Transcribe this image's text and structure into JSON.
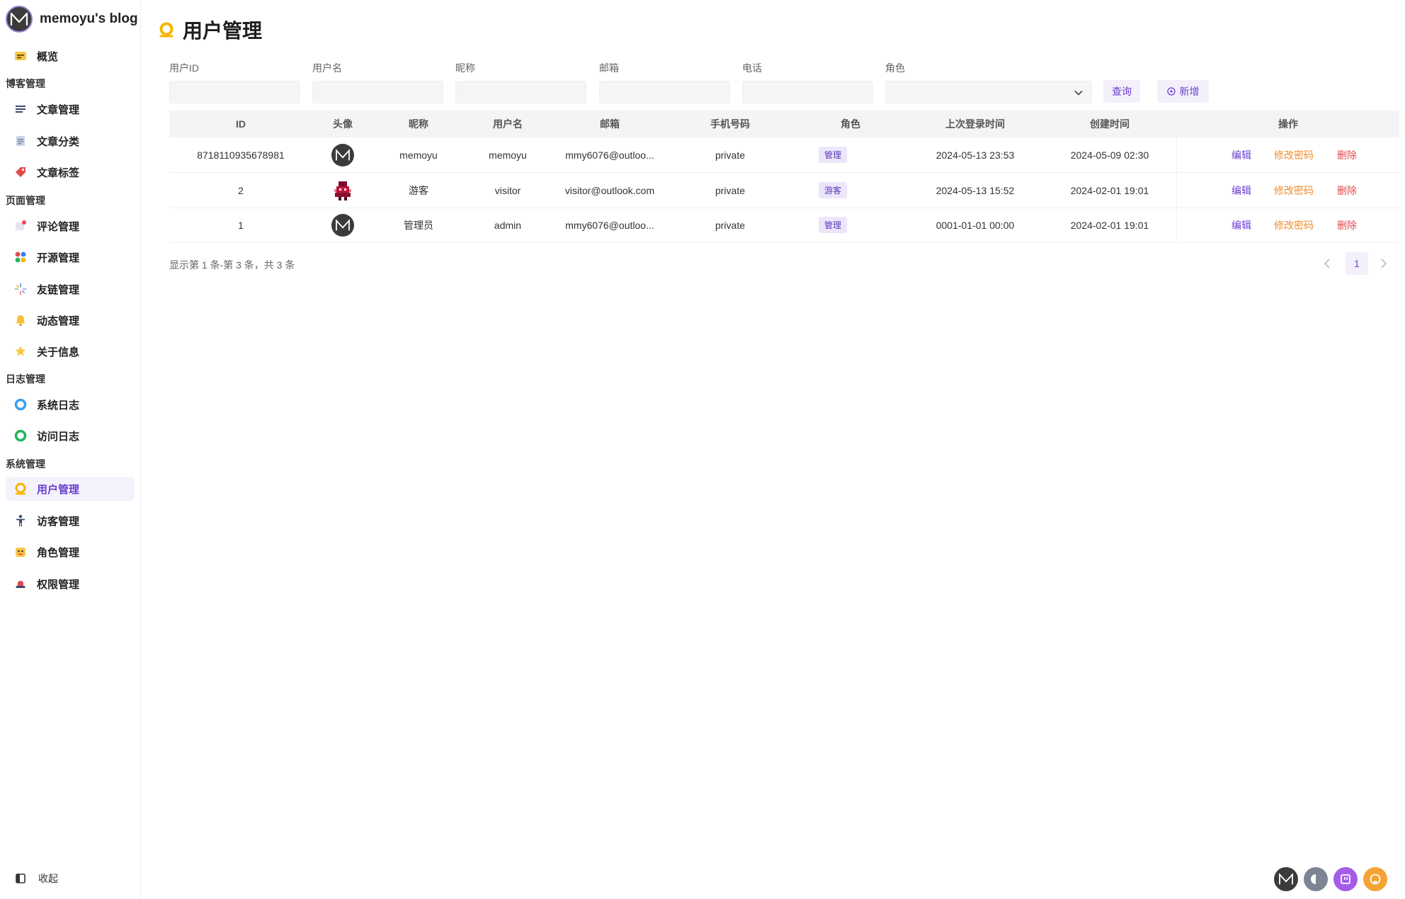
{
  "brand": {
    "title": "memoyu's blog"
  },
  "sidebar": {
    "overview": "概览",
    "groups": {
      "blog": "博客管理",
      "page": "页面管理",
      "log": "日志管理",
      "system": "系统管理"
    },
    "items": {
      "articles": "文章管理",
      "categories": "文章分类",
      "tags": "文章标签",
      "comments": "评论管理",
      "opensource": "开源管理",
      "friendlinks": "友链管理",
      "moments": "动态管理",
      "about": "关于信息",
      "syslog": "系统日志",
      "visitlog": "访问日志",
      "users": "用户管理",
      "visitors": "访客管理",
      "roles": "角色管理",
      "permissions": "权限管理"
    },
    "collapse": "收起"
  },
  "page": {
    "title": "用户管理"
  },
  "filters": {
    "user_id": {
      "label": "用户ID",
      "value": ""
    },
    "username": {
      "label": "用户名",
      "value": ""
    },
    "nickname": {
      "label": "昵称",
      "value": ""
    },
    "email": {
      "label": "邮箱",
      "value": ""
    },
    "phone": {
      "label": "电话",
      "value": ""
    },
    "role": {
      "label": "角色",
      "value": ""
    },
    "search_label": "查询",
    "add_label": "新增"
  },
  "table": {
    "headers": {
      "id": "ID",
      "avatar": "头像",
      "nickname": "昵称",
      "username": "用户名",
      "email": "邮箱",
      "phone": "手机号码",
      "role": "角色",
      "last_login": "上次登录时间",
      "created": "创建时间",
      "actions": "操作"
    },
    "rows": [
      {
        "id": "8718110935678981",
        "nickname": "memoyu",
        "username": "memoyu",
        "email": "mmy6076@outloo...",
        "phone": "private",
        "role": "管理",
        "last_login": "2024-05-13 23:53",
        "created": "2024-05-09 02:30"
      },
      {
        "id": "2",
        "nickname": "游客",
        "username": "visitor",
        "email": "visitor@outlook.com",
        "phone": "private",
        "role": "游客",
        "last_login": "2024-05-13 15:52",
        "created": "2024-02-01 19:01"
      },
      {
        "id": "1",
        "nickname": "管理员",
        "username": "admin",
        "email": "mmy6076@outloo...",
        "phone": "private",
        "role": "管理",
        "last_login": "0001-01-01 00:00",
        "created": "2024-02-01 19:01"
      }
    ],
    "actions": {
      "edit": "编辑",
      "change_password": "修改密码",
      "delete": "删除"
    }
  },
  "pagination": {
    "summary": "显示第 1 条-第 3 条，共 3 条",
    "current_page": "1"
  },
  "colors": {
    "accent": "#6a3fd1",
    "warning": "#f08c2a",
    "danger": "#e5484d"
  }
}
